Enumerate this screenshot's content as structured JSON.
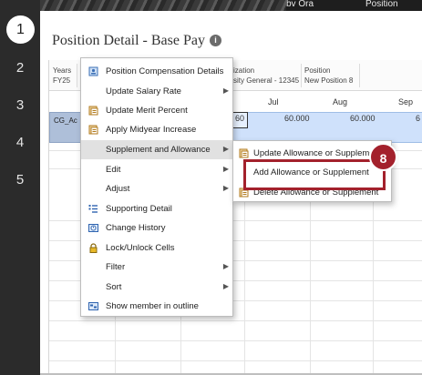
{
  "steps": [
    "1",
    "2",
    "3",
    "4",
    "5"
  ],
  "banner": {
    "left_text": "bv Ora",
    "right_text": "Position"
  },
  "page": {
    "title": "Position Detail - Base Pay",
    "info_icon": "info-icon"
  },
  "pov": [
    {
      "label": "Years",
      "value": "FY25"
    },
    {
      "label": "ization",
      "value": "sity General - 12345"
    },
    {
      "label": "Position",
      "value": "New Position 8"
    }
  ],
  "grid": {
    "columns": [
      "Jul",
      "Aug",
      "Sep"
    ],
    "row_header": "CG_Ac",
    "values": [
      "60",
      "60.000",
      "60.000",
      "6"
    ]
  },
  "menu": {
    "items": [
      {
        "label": "Position Compensation Details",
        "icon": "position-details-icon",
        "submenu": false
      },
      {
        "label": "Update Salary Rate",
        "icon": "",
        "submenu": true
      },
      {
        "label": "Update Merit Percent",
        "icon": "form-icon",
        "submenu": false
      },
      {
        "label": "Apply Midyear Increase",
        "icon": "form-icon",
        "submenu": false
      },
      {
        "label": "Supplement and Allowance",
        "icon": "",
        "submenu": true,
        "highlighted": true
      },
      {
        "label": "Edit",
        "icon": "",
        "submenu": true
      },
      {
        "label": "Adjust",
        "icon": "",
        "submenu": true
      },
      {
        "label": "Supporting Detail",
        "icon": "supporting-detail-icon",
        "submenu": false
      },
      {
        "label": "Change History",
        "icon": "change-history-icon",
        "submenu": false
      },
      {
        "label": "Lock/Unlock Cells",
        "icon": "lock-icon",
        "submenu": false
      },
      {
        "label": "Filter",
        "icon": "",
        "submenu": true
      },
      {
        "label": "Sort",
        "icon": "",
        "submenu": true
      },
      {
        "label": "Show member in outline",
        "icon": "outline-icon",
        "submenu": false
      }
    ]
  },
  "submenu": {
    "items": [
      {
        "label": "Update Allowance or Supplement",
        "icon": "form-icon"
      },
      {
        "label": "Add Allowance or Supplement",
        "icon": ""
      },
      {
        "label": "Delete Allowance or Supplement",
        "icon": "form-icon"
      }
    ]
  },
  "callout": {
    "number": "8"
  },
  "colors": {
    "rail": "#2b2b2b",
    "callout": "#a3212c",
    "row_header": "#aebfd9",
    "selection": "#cfe1fb",
    "menu_highlight": "#e1e1e1"
  }
}
